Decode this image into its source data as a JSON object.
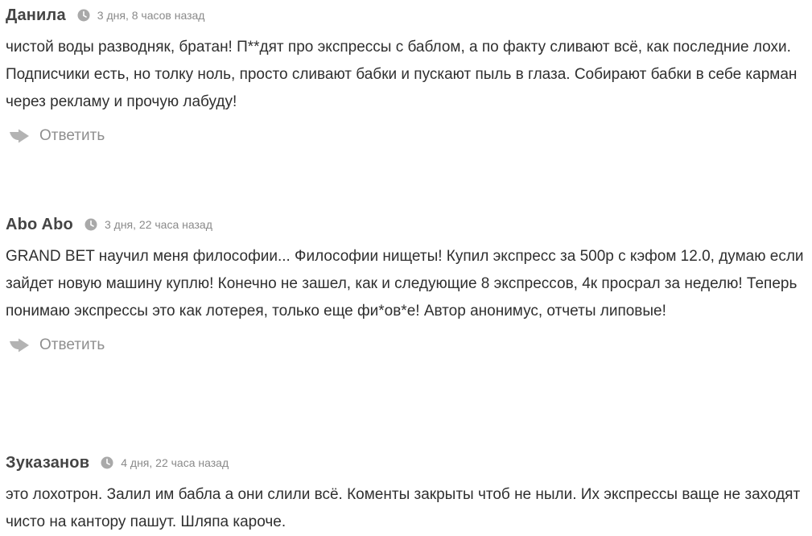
{
  "comments": [
    {
      "author": "Данила",
      "date": "3 дня, 8 часов назад",
      "text": "чистой воды разводняк, братан! П**дят про экспрессы с баблом, а по факту сливают всё, как последние лохи. Подписчики есть, но толку ноль, просто сливают бабки и пускают пыль в глаза. Собирают бабки в себе карман через рекламу и прочую лабуду!",
      "reply_label": "Ответить"
    },
    {
      "author": "Abo Abo",
      "date": "3 дня, 22 часа назад",
      "text": "GRAND BET научил меня философии... Философии нищеты! Купил экспресс за 500р с кэфом 12.0, думаю если зайдет новую машину куплю! Конечно не зашел, как и следующие 8 экспрессов, 4к просрал за неделю! Теперь понимаю экспрессы это как лотерея, только еще фи*ов*е! Автор анонимус, отчеты липовые!",
      "reply_label": "Ответить"
    },
    {
      "author": "Зуказанов",
      "date": "4 дня, 22 часа назад",
      "text": "это лохотрон. Залил им бабла а они слили всё. Коменты закрыты чтоб не ныли. Их экспрессы ваще не заходят чисто на кантору пашут. Шляпа кароче."
    }
  ],
  "icons": {
    "clock": "clock-icon",
    "reply": "reply-arrow-icon"
  },
  "colors": {
    "author": "#444444",
    "meta": "#8a8a8a",
    "text": "#2f2f2f",
    "reply": "#8f8f8f",
    "icon": "#a9a9a9"
  }
}
